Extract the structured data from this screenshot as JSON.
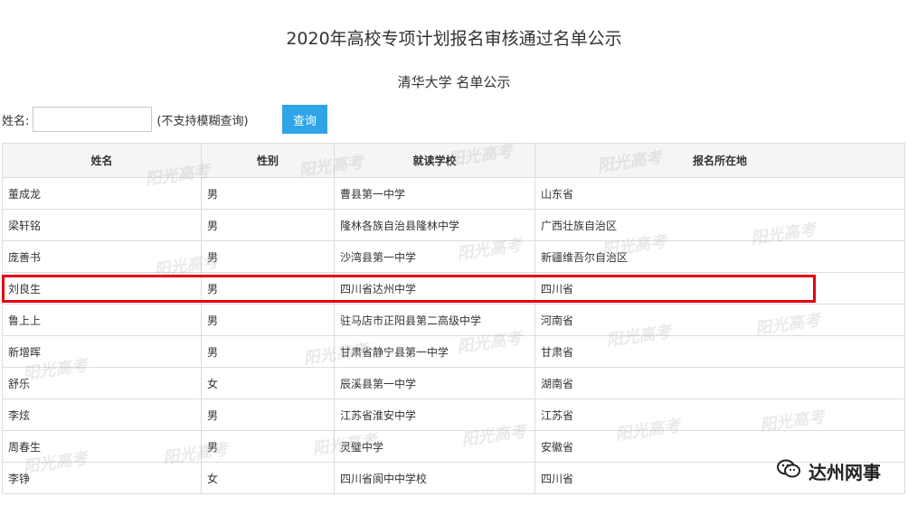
{
  "title": "2020年高校专项计划报名审核通过名单公示",
  "subtitle": "清华大学 名单公示",
  "search": {
    "label": "姓名:",
    "value": "",
    "placeholder": "",
    "hint": "(不支持模糊查询)",
    "button_label": "查询",
    "button_color": "#2fa4e7"
  },
  "table": {
    "headers": [
      "姓名",
      "性别",
      "就读学校",
      "报名所在地"
    ],
    "rows": [
      [
        "董成龙",
        "男",
        "曹县第一中学",
        "山东省"
      ],
      [
        "梁轩铭",
        "男",
        "隆林各族自治县隆林中学",
        "广西壮族自治区"
      ],
      [
        "庞善书",
        "男",
        "沙湾县第一中学",
        "新疆维吾尔自治区"
      ],
      [
        "刘良生",
        "男",
        "四川省达州中学",
        "四川省"
      ],
      [
        "鲁上上",
        "男",
        "驻马店市正阳县第二高级中学",
        "河南省"
      ],
      [
        "新增晖",
        "男",
        "甘肃省静宁县第一中学",
        "甘肃省"
      ],
      [
        "舒乐",
        "女",
        "辰溪县第一中学",
        "湖南省"
      ],
      [
        "李炫",
        "男",
        "江苏省淮安中学",
        "江苏省"
      ],
      [
        "周春生",
        "男",
        "灵璧中学",
        "安徽省"
      ],
      [
        "李铮",
        "女",
        "四川省阆中中学校",
        "四川省"
      ]
    ],
    "highlight_color": "#e60012"
  },
  "watermark_text": "阳光高考",
  "brand": {
    "name": "达州网事",
    "icon": "wechat-icon"
  }
}
